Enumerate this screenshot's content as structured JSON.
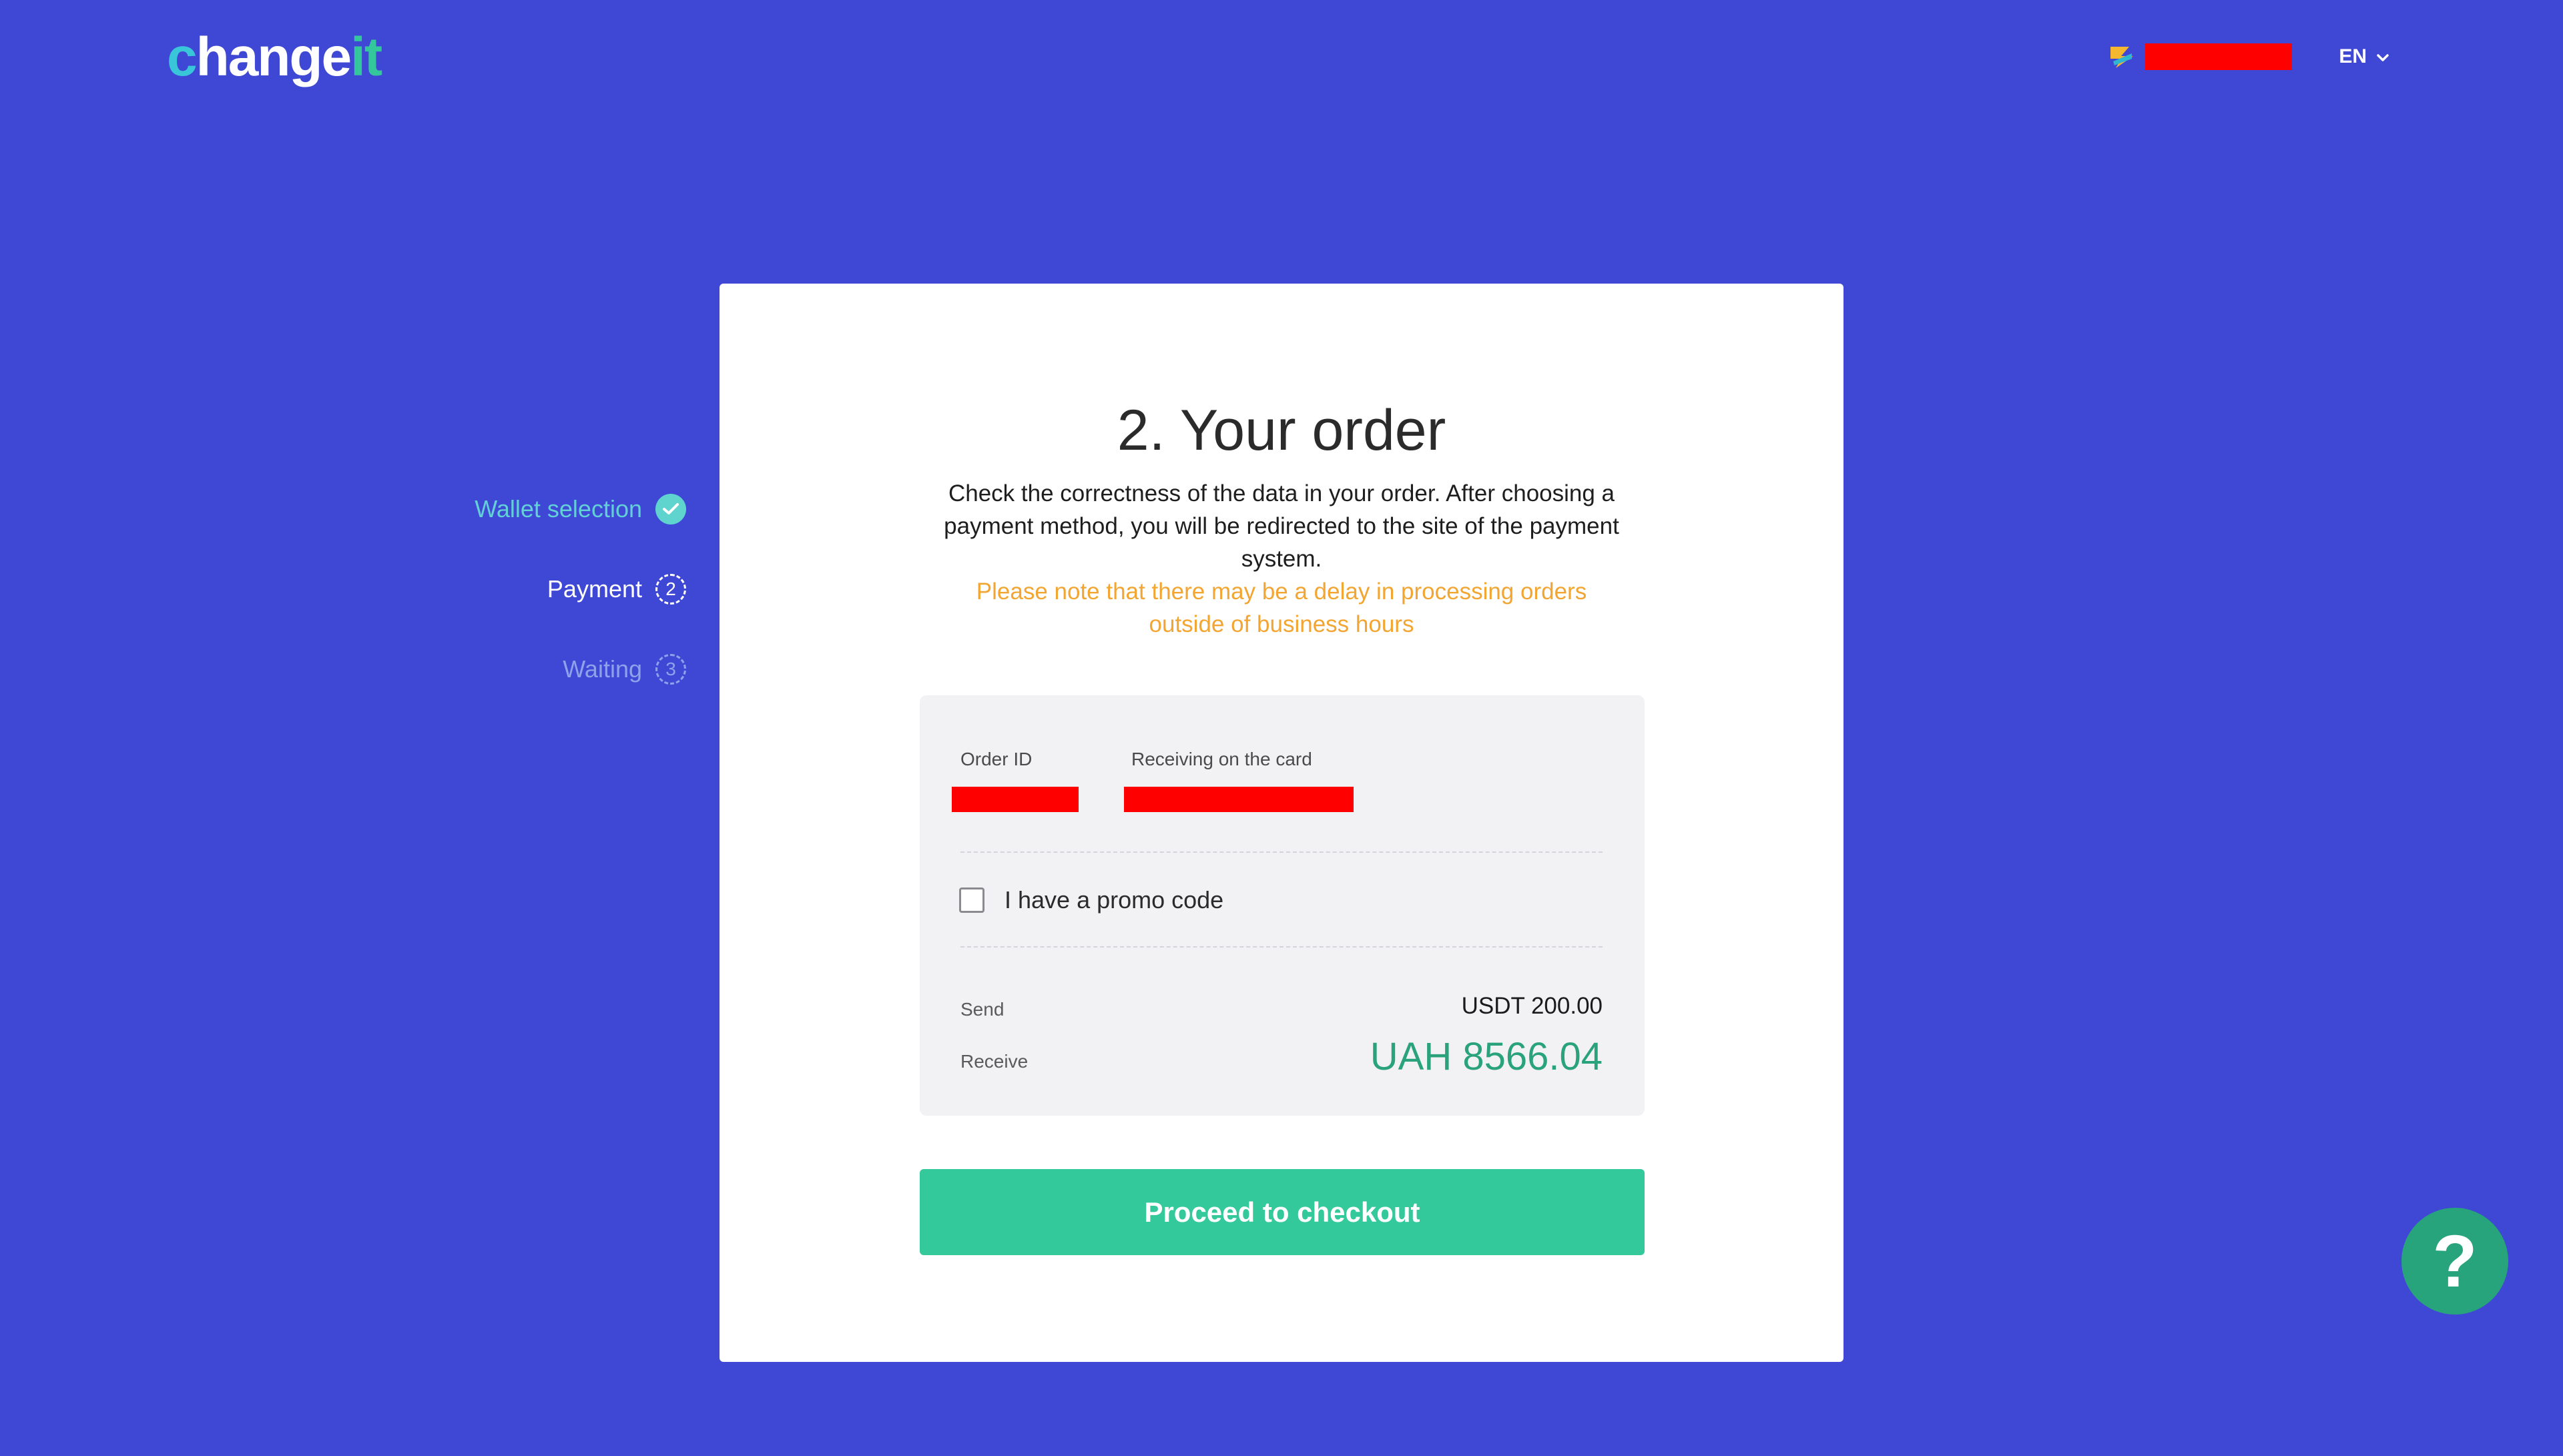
{
  "header": {
    "logo": {
      "part1": "c",
      "part2": "hange",
      "part3": "it"
    },
    "language": "EN",
    "icons": {
      "user": "user-logo-icon",
      "language_dropdown": "chevron-down-icon"
    }
  },
  "steps": [
    {
      "label": "Wallet selection",
      "state": "done",
      "icon": "check-icon"
    },
    {
      "label": "Payment",
      "state": "active",
      "number": "2"
    },
    {
      "label": "Waiting",
      "state": "pending",
      "number": "3"
    }
  ],
  "order": {
    "title": "2. Your order",
    "description": "Check the correctness of the data in your order. After choosing a payment method, you will be redirected to the site of the payment system.",
    "note": "Please note that there may be a delay in processing orders outside of business hours",
    "order_id_label": "Order ID",
    "receiving_label": "Receiving on the card",
    "promo_label": "I have a promo code",
    "send_label": "Send",
    "send_value": "USDT 200.00",
    "receive_label": "Receive",
    "receive_value": "UAH 8566.04",
    "checkout_label": "Proceed to checkout"
  },
  "help": {
    "label": "?"
  },
  "colors": {
    "background": "#3f48d5",
    "accent_green": "#34c99b",
    "receive_green": "#2aa37b",
    "note_orange": "#f3a531",
    "redaction": "#ff0000"
  }
}
